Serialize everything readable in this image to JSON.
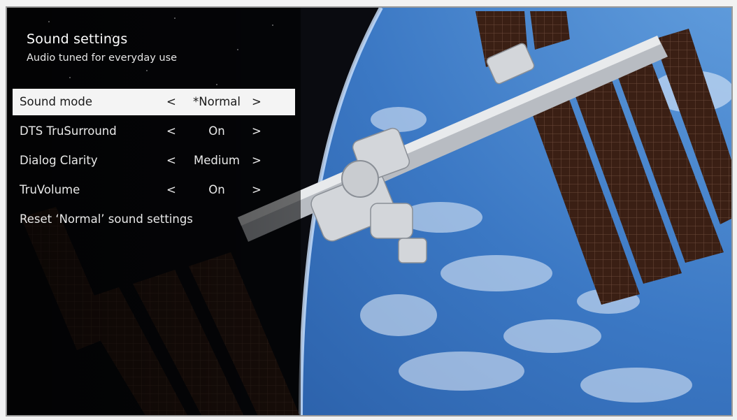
{
  "menu": {
    "title": "Sound settings",
    "subtitle": "Audio tuned for everyday use",
    "items": [
      {
        "label": "Sound mode",
        "value": "*Normal",
        "left": "<",
        "right": ">",
        "selected": true
      },
      {
        "label": "DTS TruSurround",
        "value": "On",
        "left": "<",
        "right": ">"
      },
      {
        "label": "Dialog Clarity",
        "value": "Medium",
        "left": "<",
        "right": ">"
      },
      {
        "label": "TruVolume",
        "value": "On",
        "left": "<",
        "right": ">"
      }
    ],
    "reset_label": "Reset ‘Normal’ sound settings"
  },
  "colors": {
    "space": "#0a0b10",
    "earth_ocean": "#3b78c4",
    "selected_row_bg": "#f4f4f4",
    "text": "#e9e9e9"
  },
  "background": "space-station-over-earth-image"
}
